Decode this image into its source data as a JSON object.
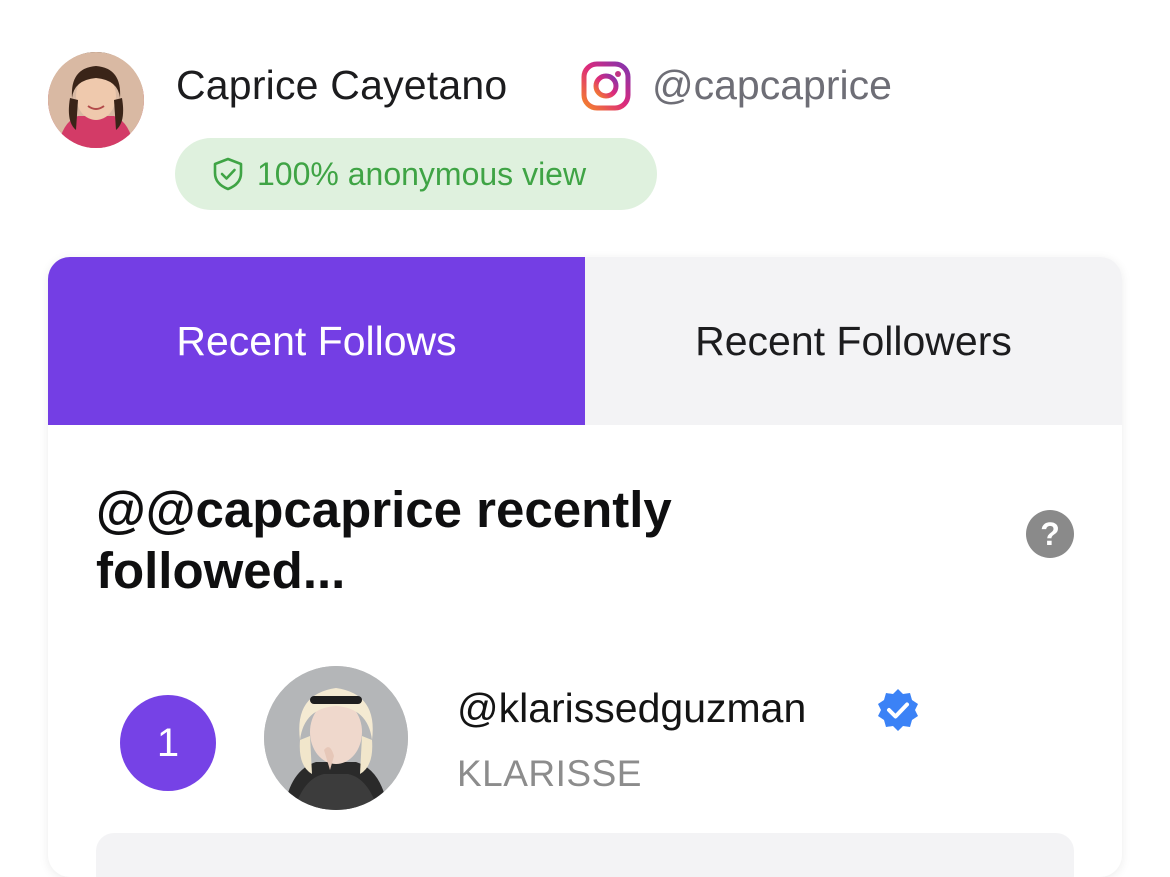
{
  "profile": {
    "name": "Caprice Cayetano",
    "handle": "@capcaprice",
    "anonymous_badge": "100% anonymous view"
  },
  "tabs": [
    {
      "label": "Recent Follows",
      "active": true
    },
    {
      "label": "Recent Followers",
      "active": false
    }
  ],
  "section": {
    "title": "@@capcaprice recently followed...",
    "help_symbol": "?"
  },
  "list": [
    {
      "rank": "1",
      "username": "@klarissedguzman",
      "display_name": "KLARISSE",
      "verified": true
    }
  ],
  "colors": {
    "accent": "#743ee4",
    "badge_bg": "#dff1de",
    "badge_text": "#3fa445",
    "verified": "#3b82f6"
  }
}
